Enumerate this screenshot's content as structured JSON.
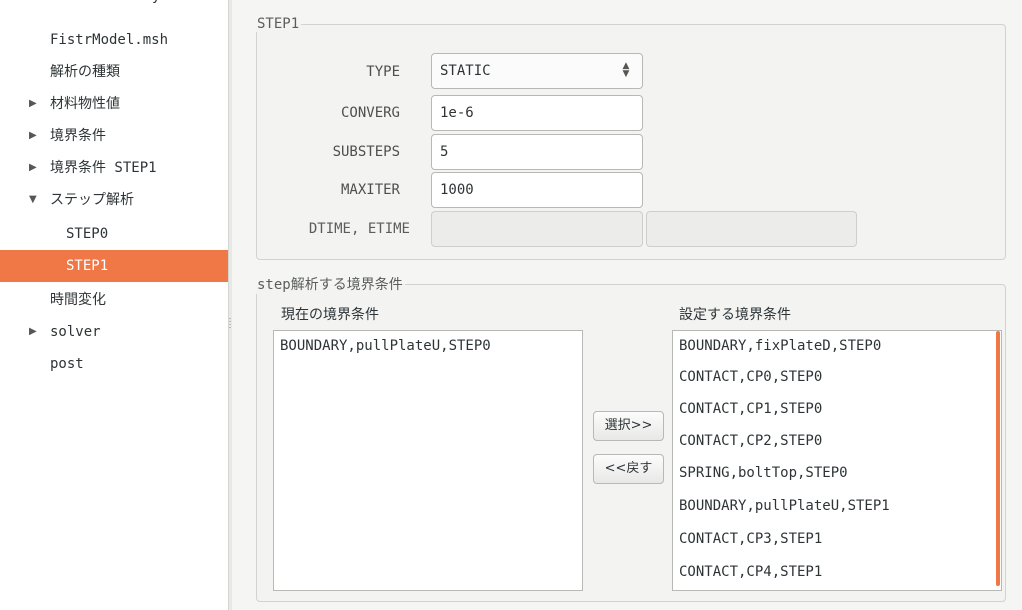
{
  "tree": {
    "items": [
      {
        "label": "FrontISTR analysis",
        "arrow": "",
        "indent": 0
      },
      {
        "label": "FistrModel.msh",
        "arrow": "",
        "indent": 1
      },
      {
        "label": "解析の種類",
        "arrow": "",
        "indent": 1
      },
      {
        "label": "材料物性値",
        "arrow": "▶",
        "indent": 1
      },
      {
        "label": "境界条件",
        "arrow": "▶",
        "indent": 1
      },
      {
        "label": "境界条件 STEP1",
        "arrow": "▶",
        "indent": 1
      },
      {
        "label": "ステップ解析",
        "arrow": "▼",
        "indent": 1
      },
      {
        "label": "STEP0",
        "arrow": "",
        "indent": 2
      },
      {
        "label": "STEP1",
        "arrow": "",
        "indent": 2,
        "selected": true
      },
      {
        "label": "時間変化",
        "arrow": "",
        "indent": 1
      },
      {
        "label": "solver",
        "arrow": "▶",
        "indent": 1
      },
      {
        "label": "post",
        "arrow": "",
        "indent": 1
      }
    ]
  },
  "step_frame": {
    "legend": "STEP1",
    "type_label": "TYPE",
    "type_value": "STATIC",
    "converg_label": "CONVERG",
    "converg_value": "1e-6",
    "substeps_label": "SUBSTEPS",
    "substeps_value": "5",
    "maxiter_label": "MAXITER",
    "maxiter_value": "1000",
    "dtime_label": "DTIME, ETIME",
    "dtime_value": "",
    "etime_value": ""
  },
  "bc_frame": {
    "legend": "step解析する境界条件",
    "current_title": "現在の境界条件",
    "current_items": [
      "BOUNDARY,pullPlateU,STEP0"
    ],
    "select_button": "選択>>",
    "back_button": "<<戻す",
    "setting_title": "設定する境界条件",
    "setting_items": [
      "BOUNDARY,fixPlateD,STEP0",
      "CONTACT,CP0,STEP0",
      "CONTACT,CP1,STEP0",
      "CONTACT,CP2,STEP0",
      "SPRING,boltTop,STEP0",
      "BOUNDARY,pullPlateU,STEP1",
      "CONTACT,CP3,STEP1",
      "CONTACT,CP4,STEP1"
    ]
  },
  "colors": {
    "selection": "#f07746",
    "panel_bg": "#f5f5f4"
  }
}
